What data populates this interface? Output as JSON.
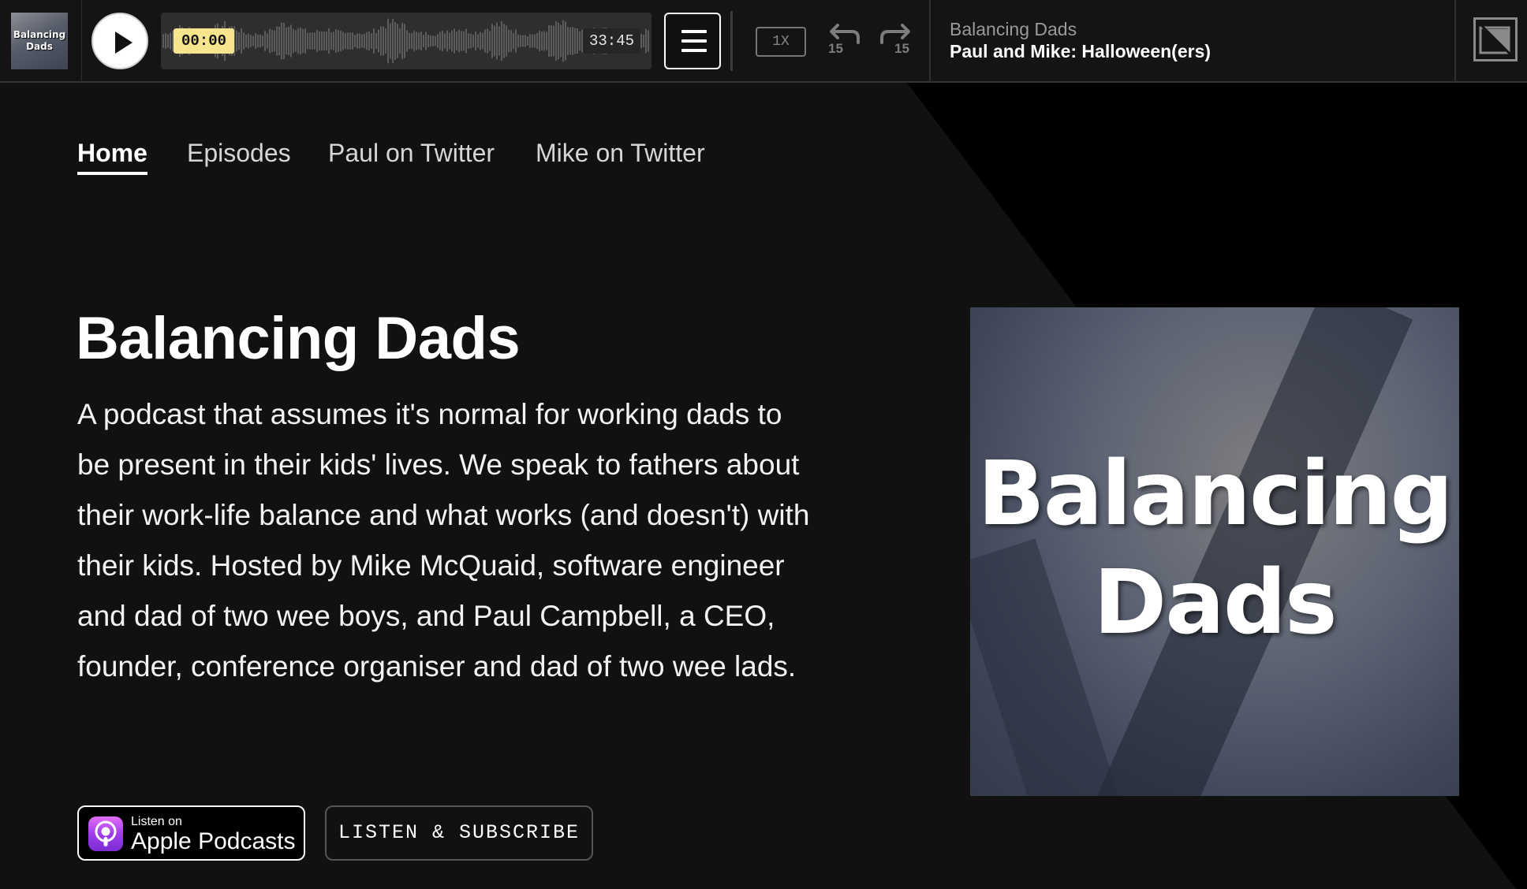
{
  "player": {
    "thumb_text": "Balancing Dads",
    "time_current": "00:00",
    "time_total": "33:45",
    "speed": "1X",
    "skip_back": "15",
    "skip_forward": "15",
    "show_name": "Balancing Dads",
    "episode_title": "Paul and Mike: Halloween(ers)",
    "progress": 0
  },
  "nav": {
    "items": [
      {
        "label": "Home",
        "active": true
      },
      {
        "label": "Episodes",
        "active": false
      },
      {
        "label": "Paul on Twitter",
        "active": false
      },
      {
        "label": "Mike on Twitter",
        "active": false
      }
    ]
  },
  "hero": {
    "title": "Balancing Dads",
    "description": "A podcast that assumes it's normal for working dads to be present in their kids' lives. We speak to fathers about their work-life balance and what works (and doesn't) with their kids. Hosted by Mike McQuaid, software engineer and dad of two wee boys, and Paul Campbell, a CEO, founder, conference organiser and dad of two wee lads.",
    "apple_small": "Listen on",
    "apple_big": "Apple Podcasts",
    "subscribe_label": "LISTEN & SUBSCRIBE",
    "cover_line1": "Balancing",
    "cover_line2": "Dads"
  },
  "colors": {
    "background": "#111111",
    "accent_panel": "#000000",
    "time_badge": "#f6e58d",
    "text": "#ffffff"
  },
  "icons": {
    "play": "play-icon",
    "menu": "hamburger-menu-icon",
    "skip_back": "rewind-15-icon",
    "skip_forward": "forward-15-icon",
    "logo": "site-logo-icon",
    "apple": "apple-podcasts-icon"
  }
}
